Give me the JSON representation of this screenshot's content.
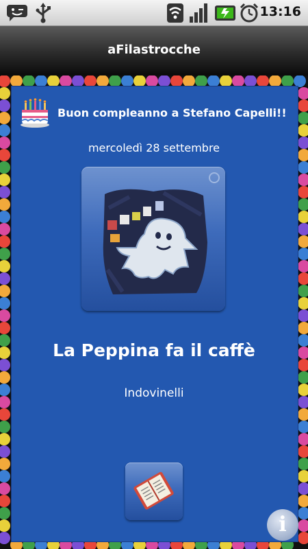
{
  "status_bar": {
    "time": "13:16",
    "icons": [
      "notification-smile-icon",
      "usb-icon",
      "wifi-icon",
      "signal-icon",
      "battery-charging-icon",
      "alarm-icon"
    ]
  },
  "app": {
    "title": "aFilastrocche"
  },
  "birthday": {
    "icon": "birthday-cake-icon",
    "message": "Buon compleanno a Stefano Capelli!!"
  },
  "date_label": "mercoledì 28 settembre",
  "story": {
    "title": "La Peppina fa il caffè",
    "category": "Indovinelli",
    "image_icon": "ghost-picture-icon"
  },
  "actions": {
    "book_icon": "book-icon",
    "info_icon": "info-icon",
    "info_glyph": "i"
  },
  "colors": {
    "panel": "#2358b0",
    "frame": "#111111",
    "text": "#ffffff"
  }
}
